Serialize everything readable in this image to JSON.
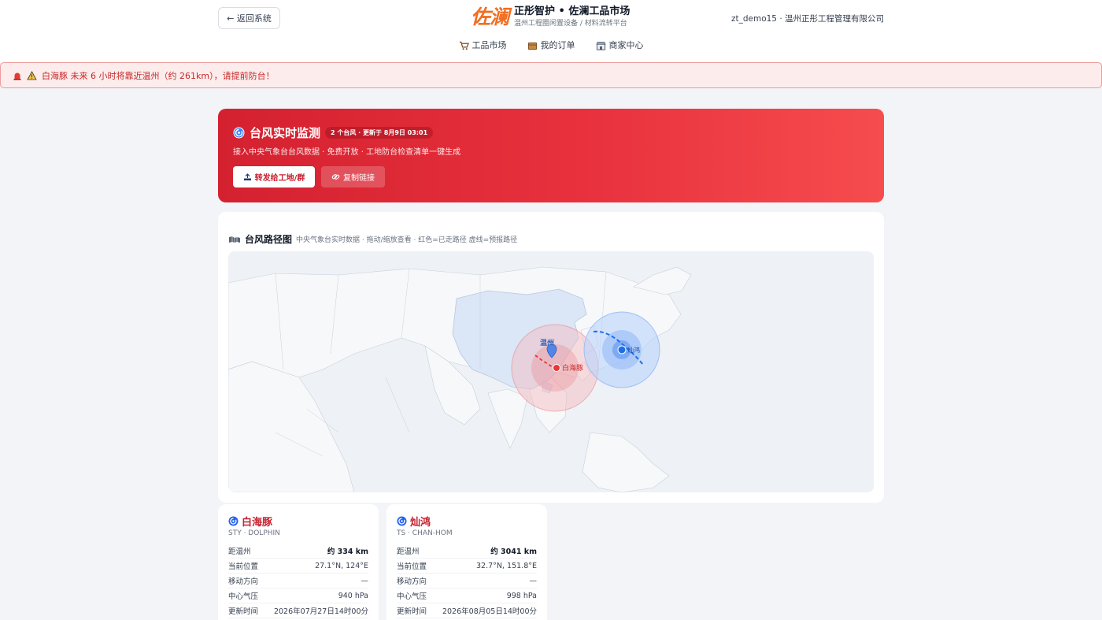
{
  "header": {
    "back_label": "← 返回系统",
    "logo_text": "佐澜",
    "title": "正彤智护 • 佐澜工品市场",
    "subtitle": "温州工程圈闲置设备 / 材料流转平台",
    "user": "zt_demo15 · 温州正彤工程管理有限公司"
  },
  "nav": [
    {
      "label": "工品市场",
      "icon": "cart-icon"
    },
    {
      "label": "我的订单",
      "icon": "box-icon"
    },
    {
      "label": "商家中心",
      "icon": "store-icon"
    }
  ],
  "alert": {
    "text": "白海豚 未来 6 小时将靠近温州（约 261km），请提前防台！"
  },
  "hero": {
    "title": "台风实时监测",
    "badge": "2 个台风 · 更新于 8月9日 03:01",
    "desc": "接入中央气象台台风数据 · 免费开放 · 工地防台检查清单一键生成",
    "share_button": "转发给工地/群",
    "copy_button": "复制链接"
  },
  "map": {
    "title": "台风路径图",
    "subtitle": "中央气象台实时数据 · 拖动/缩放查看 · 红色=已走路径 虚线=预报路径",
    "city_label": "温州",
    "typhoon1_label": "白海豚",
    "typhoon2_label": "灿鸿",
    "colors": {
      "past": "#e53935",
      "forecast": "#1e6fe8",
      "land": "#dbe6f6",
      "sea": "#eef1f5"
    }
  },
  "typhoons": [
    {
      "name": "白海豚",
      "code": "STY · DOLPHIN",
      "rows": [
        {
          "label": "距温州",
          "value": "约 334 km",
          "bold": true
        },
        {
          "label": "当前位置",
          "value": "27.1°N, 124°E"
        },
        {
          "label": "移动方向",
          "value": "—"
        },
        {
          "label": "中心气压",
          "value": "940 hPa"
        },
        {
          "label": "更新时间",
          "value": "2026年07月27日14时00分"
        }
      ]
    },
    {
      "name": "灿鸿",
      "code": "TS · CHAN-HOM",
      "rows": [
        {
          "label": "距温州",
          "value": "约 3041 km",
          "bold": true
        },
        {
          "label": "当前位置",
          "value": "32.7°N, 151.8°E"
        },
        {
          "label": "移动方向",
          "value": "—"
        },
        {
          "label": "中心气压",
          "value": "998 hPa"
        },
        {
          "label": "更新时间",
          "value": "2026年08月05日14时00分"
        }
      ]
    }
  ]
}
